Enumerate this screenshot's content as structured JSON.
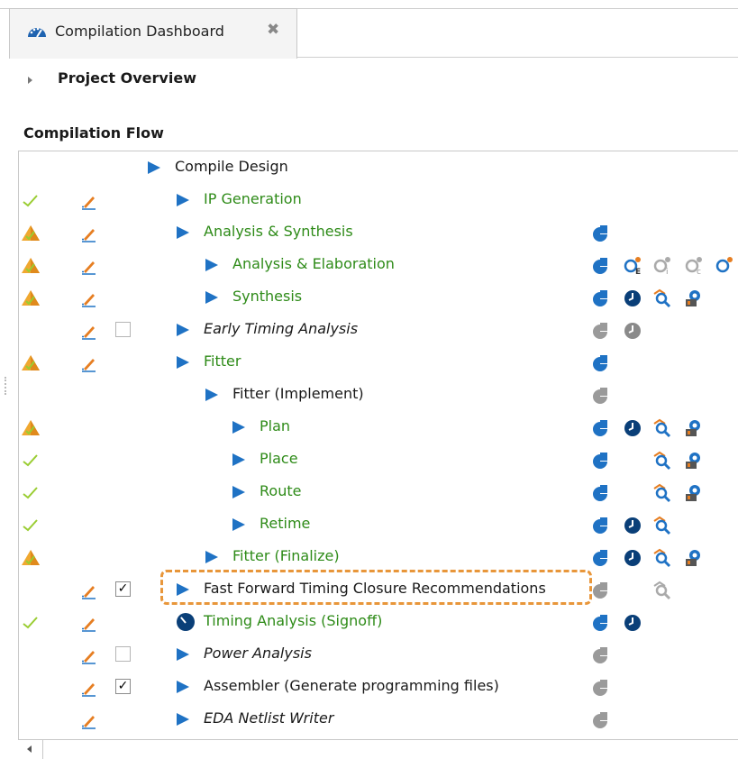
{
  "tab": {
    "title": "Compilation Dashboard",
    "close": "✖"
  },
  "overview": {
    "label": "Project Overview"
  },
  "flow": {
    "title": "Compilation Flow"
  },
  "colors": {
    "accent": "#1f72c4",
    "done_green": "#2e8b18",
    "warning_orange": "#e6962c",
    "highlight_dash": "#e8963a"
  },
  "rows": [
    {
      "label": "Compile Design",
      "status": "",
      "edit": false,
      "checkbox": "",
      "style": "normal",
      "level": 0,
      "reports": []
    },
    {
      "label": "IP Generation",
      "status": "check",
      "edit": true,
      "checkbox": "",
      "style": "green",
      "level": 1,
      "reports": []
    },
    {
      "label": "Analysis & Synthesis",
      "status": "warning",
      "edit": true,
      "checkbox": "",
      "style": "green",
      "level": 1,
      "reports": [
        "report-icon"
      ]
    },
    {
      "label": "Analysis & Elaboration",
      "status": "warning",
      "edit": true,
      "checkbox": "",
      "style": "green",
      "level": 2,
      "reports": [
        "report-icon",
        "elab-icon",
        "query-gray-icon",
        "compare-gray-icon",
        "query-partial-icon"
      ]
    },
    {
      "label": "Synthesis",
      "status": "warning",
      "edit": true,
      "checkbox": "",
      "style": "green",
      "level": 2,
      "reports": [
        "report-icon",
        "timing-clock-icon",
        "chip-planner-icon",
        "netlist-viewer-icon"
      ]
    },
    {
      "label": "Early Timing Analysis",
      "status": "",
      "edit": true,
      "checkbox": "unchecked",
      "style": "italic",
      "level": 1,
      "reports": [
        "report-gray-icon",
        "timing-clock-gray-icon"
      ]
    },
    {
      "label": "Fitter",
      "status": "warning",
      "edit": true,
      "checkbox": "",
      "style": "green",
      "level": 1,
      "reports": [
        "report-icon"
      ]
    },
    {
      "label": "Fitter (Implement)",
      "status": "",
      "edit": false,
      "checkbox": "",
      "style": "normal",
      "level": 2,
      "reports": [
        "report-gray-icon"
      ]
    },
    {
      "label": "Plan",
      "status": "warning",
      "edit": false,
      "checkbox": "",
      "style": "green",
      "level": 3,
      "reports": [
        "report-icon",
        "timing-clock-icon",
        "chip-planner-icon",
        "netlist-viewer-icon"
      ]
    },
    {
      "label": "Place",
      "status": "check",
      "edit": false,
      "checkbox": "",
      "style": "green",
      "level": 3,
      "reports": [
        "report-icon",
        "",
        "chip-planner-icon",
        "netlist-viewer-icon"
      ]
    },
    {
      "label": "Route",
      "status": "check",
      "edit": false,
      "checkbox": "",
      "style": "green",
      "level": 3,
      "reports": [
        "report-icon",
        "",
        "chip-planner-icon",
        "netlist-viewer-icon"
      ]
    },
    {
      "label": "Retime",
      "status": "check",
      "edit": false,
      "checkbox": "",
      "style": "green",
      "level": 3,
      "reports": [
        "report-icon",
        "timing-clock-icon",
        "chip-planner-icon"
      ]
    },
    {
      "label": "Fitter (Finalize)",
      "status": "warning",
      "edit": false,
      "checkbox": "",
      "style": "green",
      "level": 2,
      "reports": [
        "report-icon",
        "timing-clock-icon",
        "chip-planner-icon",
        "netlist-viewer-icon"
      ]
    },
    {
      "label": "Fast Forward Timing Closure Recommendations",
      "status": "",
      "edit": true,
      "checkbox": "checked",
      "style": "normal",
      "level": 1,
      "reports": [
        "report-gray-icon",
        "",
        "chip-planner-gray-icon"
      ]
    },
    {
      "label": "Timing Analysis (Signoff)",
      "status": "check",
      "edit": true,
      "checkbox": "",
      "style": "green",
      "level": 1,
      "task_icon": "clock",
      "reports": [
        "report-icon",
        "timing-clock-icon"
      ]
    },
    {
      "label": "Power Analysis",
      "status": "",
      "edit": true,
      "checkbox": "unchecked",
      "style": "italic",
      "level": 1,
      "reports": [
        "report-gray-icon"
      ]
    },
    {
      "label": "Assembler (Generate programming files)",
      "status": "",
      "edit": true,
      "checkbox": "checked",
      "style": "normal",
      "level": 1,
      "reports": [
        "report-gray-icon"
      ]
    },
    {
      "label": "EDA Netlist Writer",
      "status": "",
      "edit": true,
      "checkbox": "",
      "style": "italic",
      "level": 1,
      "reports": [
        "report-gray-icon"
      ]
    }
  ],
  "checkmark": "✓",
  "scroll": {
    "left_icon": "scroll-left-icon"
  }
}
